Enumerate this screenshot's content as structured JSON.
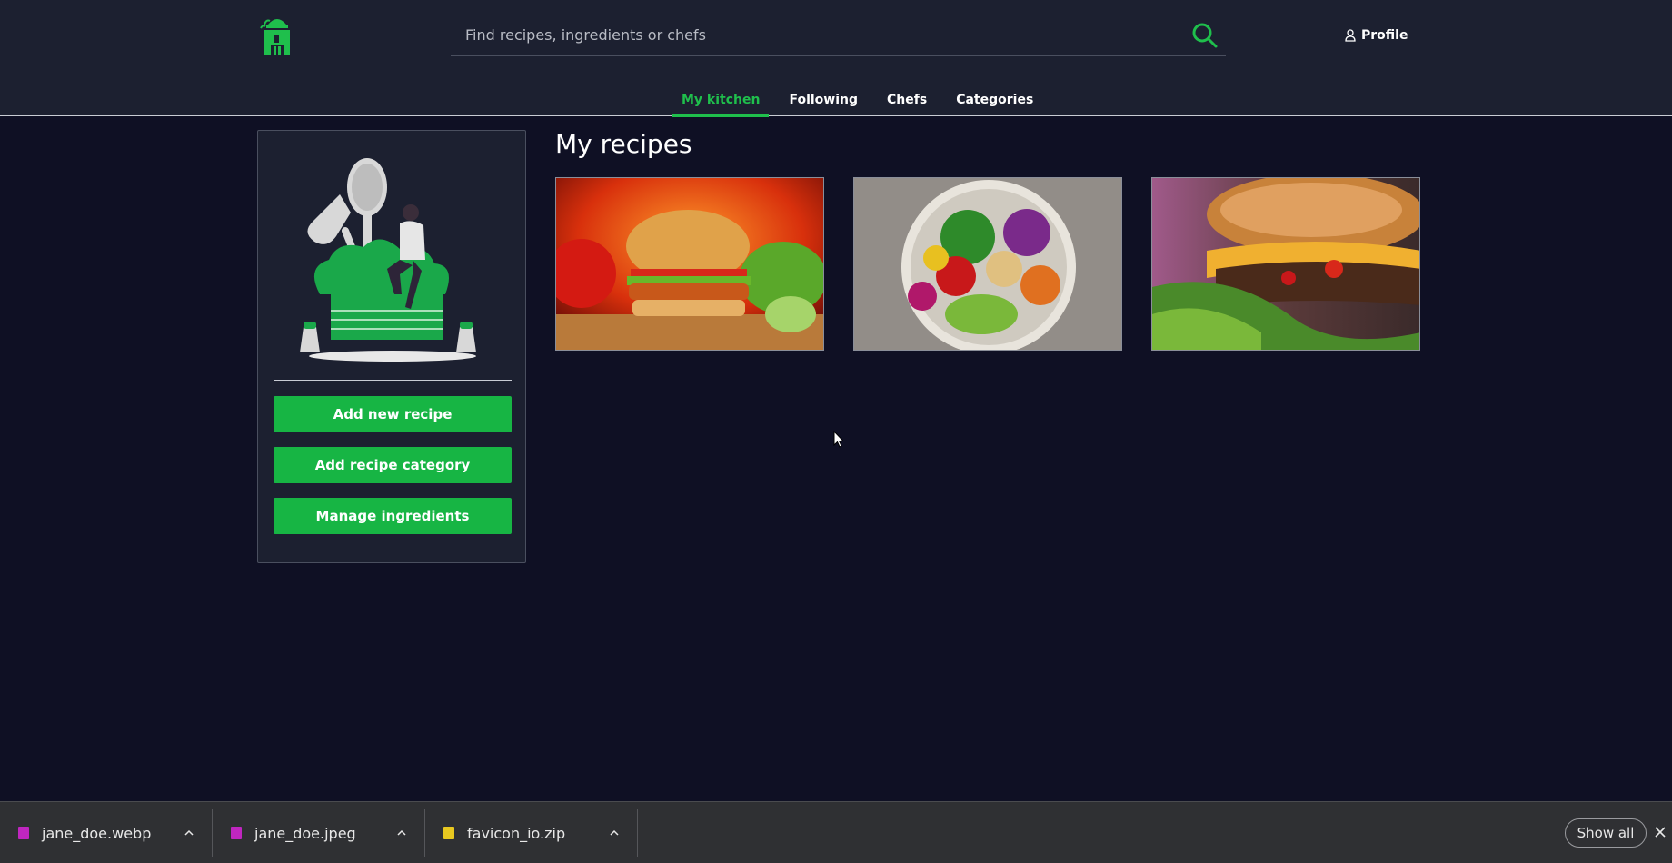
{
  "header": {
    "search": {
      "placeholder": "Find recipes, ingredients or chefs",
      "value": ""
    },
    "profile_label": "Profile",
    "nav_tabs": [
      {
        "label": "My kitchen",
        "active": true
      },
      {
        "label": "Following",
        "active": false
      },
      {
        "label": "Chefs",
        "active": false
      },
      {
        "label": "Categories",
        "active": false
      }
    ]
  },
  "sidebar": {
    "buttons": {
      "add_recipe": "Add new recipe",
      "add_category": "Add recipe category",
      "manage_ingredients": "Manage ingredients"
    }
  },
  "main": {
    "title": "My recipes",
    "recipes": [
      {
        "image": "burger-with-tomato-and-lettuce"
      },
      {
        "image": "salad-bowl"
      },
      {
        "image": "cheeseburger-closeup"
      }
    ]
  },
  "downloads": {
    "items": [
      {
        "name": "jane_doe.webp",
        "icon": "image-file-icon"
      },
      {
        "name": "jane_doe.jpeg",
        "icon": "image-file-icon"
      },
      {
        "name": "favicon_io.zip",
        "icon": "zip-file-icon"
      }
    ],
    "show_all_label": "Show all"
  },
  "colors": {
    "accent": "#1fbf4c",
    "button": "#17b544",
    "background": "#0f1024",
    "header": "#1c2030"
  }
}
